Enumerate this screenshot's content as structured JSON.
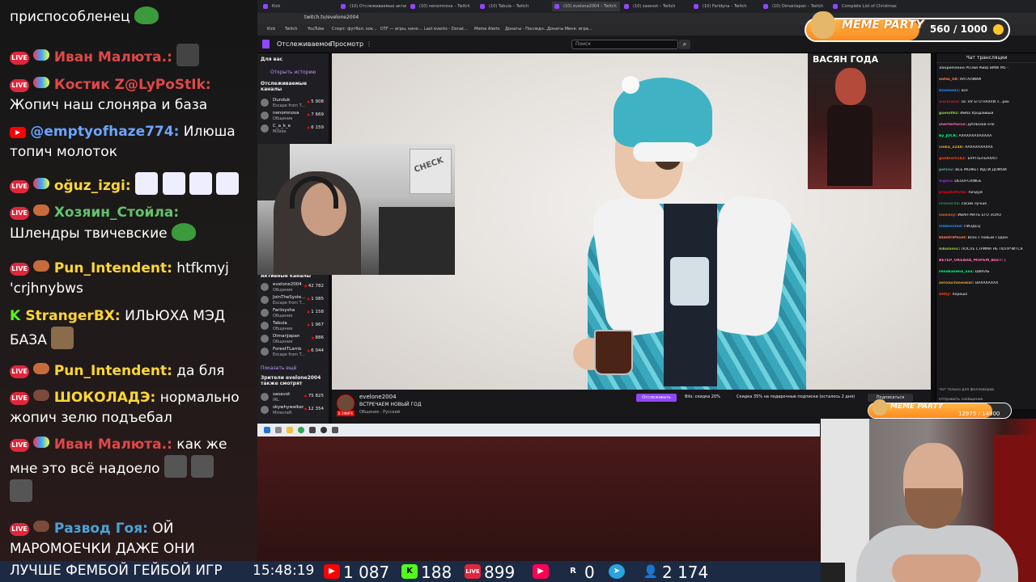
{
  "chat": {
    "messages": [
      {
        "platform": "twitch",
        "nick": "",
        "nick_color": "#ffffff",
        "text": "приспособленец"
      },
      {
        "platform": "vk",
        "nick": "Иван Малюта.:",
        "nick_color": "#e04848",
        "text": ""
      },
      {
        "platform": "vk",
        "nick": "Костик Z@LyPoStIk:",
        "nick_color": "#e04848",
        "text": "Жопич наш слоняра и база"
      },
      {
        "platform": "youtube",
        "nick": "@emptyofhaze774:",
        "nick_color": "#6aa5ff",
        "text": "Илюша топич молоток"
      },
      {
        "platform": "vk",
        "nick": "oğuz_izgi:",
        "nick_color": "#ffd733",
        "text": ""
      },
      {
        "platform": "vk",
        "nick": "Хозяин_Стойла:",
        "nick_color": "#63c26b",
        "text": "Шлендры твичевские"
      },
      {
        "platform": "vk",
        "nick": "Pun_Intendent:",
        "nick_color": "#ffd733",
        "text": "htfkmyj 'crjhnybws"
      },
      {
        "platform": "kick",
        "nick": "StrangerBX:",
        "nick_color": "#ffd733",
        "text": "ИЛЬЮХА МЭД БАЗА"
      },
      {
        "platform": "vk",
        "nick": "Pun_Intendent:",
        "nick_color": "#ffd733",
        "text": "да бля"
      },
      {
        "platform": "vk",
        "nick": "ШОКОЛАДЭ:",
        "nick_color": "#ffd733",
        "text": "нормально жопич зелю подъебал"
      },
      {
        "platform": "vk",
        "nick": "Иван Малюта.:",
        "nick_color": "#e04848",
        "text": "как же мне это всё надоело"
      },
      {
        "platform": "vk",
        "nick": "Развод Гоя:",
        "nick_color": "#4aa3d8",
        "text": "ОЙ МАРОМОЕЧКИ ДАЖЕ ОНИ"
      }
    ]
  },
  "browser": {
    "tabs": [
      "Kick",
      "(10) Отслеживаемые активн.",
      "(10) nenomnova – Twitch",
      "(10) Tabula – Twitch",
      "(10) evelone2004 – Twitch",
      "(10) zasevot – Twitch",
      "(10) Feridyna – Twitch",
      "(10) Dimanlapan – Twitch",
      "Complete List of Christmas"
    ],
    "url": "twitch.tv/evelone2004",
    "bookmarks": [
      "Kick",
      "Twitch",
      "YouTube",
      "Спорт: футбол, хок...",
      "DTF — игры, кино...",
      "Last events - Donat...",
      "Meme Alerts",
      "Донаты - Последн...",
      "Донаты Меня: игра..."
    ],
    "nav": {
      "following": "Отслеживаемое",
      "browse": "Просмотр",
      "search_placeholder": "Поиск"
    },
    "sidenav": {
      "for_you": "Для вас",
      "open_history": "Открыть историю",
      "followed_header": "Отслеживаемые каналы",
      "followed": [
        {
          "name": "Dunduk",
          "game": "Escape from T...",
          "viewers": "5 908"
        },
        {
          "name": "nenomnova",
          "game": "Общение",
          "viewers": "7 669"
        },
        {
          "name": "C_a_k_e",
          "game": "MiSide",
          "viewers": "6 159"
        }
      ],
      "active_header": "Активные каналы",
      "active": [
        {
          "name": "evelone2004",
          "game": "Общение",
          "viewers": "42 782"
        },
        {
          "name": "JoinTheSyste...",
          "game": "Escape from T...",
          "viewers": "1 085"
        },
        {
          "name": "Fariisysha",
          "game": "Общение",
          "viewers": "1 158"
        },
        {
          "name": "Tabula",
          "game": "Общение",
          "viewers": "1 967"
        },
        {
          "name": "DimanJapan",
          "game": "Общение",
          "viewers": "886"
        },
        {
          "name": "ForestTLamb",
          "game": "Escape from T...",
          "viewers": "6 044"
        }
      ],
      "show_more": "Показать ещё",
      "also_watch": "Зрители evelone2004 также смотрят",
      "recommended": [
        {
          "name": "sasavot",
          "game": "IRL",
          "viewers": "75 825"
        },
        {
          "name": "skywhywalker",
          "game": "Minecraft",
          "viewers": "12 354"
        }
      ]
    },
    "stream": {
      "poster_text": "ВАСЯН ГОДА",
      "streamer": "evelone2004",
      "title": "ВСТРЕЧАЕМ НОВЫЙ ГОД",
      "tags": "Общение · Русский",
      "live": "В ЭФИРЕ",
      "follow": "Отслеживать",
      "bits_offer": "Bits: скидка 20%",
      "sub_offer": "Скидка 35% на подарочные подписки (осталось 2 дня)",
      "subscribe": "Подписаться"
    },
    "twitch_chat": {
      "header": "Чат трансляции",
      "lines": [
        {
          "nick": "Закреплено",
          "color": "#adadb8",
          "text": "РОЗЫГРЫШ BMW M5 -"
        },
        {
          "nick": "sofas_58:",
          "color": "#ff7f50",
          "text": "НАТАЛИИИ"
        },
        {
          "nick": "Doomed1:",
          "color": "#1e90ff",
          "text": "все"
        },
        {
          "nick": "wormand:",
          "color": "#b22222",
          "text": "за: НУ ЕГО НАХУЙ з...рек"
        },
        {
          "nick": "guenit92:",
          "color": "#9acd32",
          "text": "Имба Уродливый"
        },
        {
          "nick": "sherterforce:",
          "color": "#ff69b4",
          "text": "ДАЛБОЁВ еле"
        },
        {
          "nick": "by_JOCK:",
          "color": "#00ff7f",
          "text": "АХАХАХАХАХАХА"
        },
        {
          "nick": "cieba_2248:",
          "color": "#daa520",
          "text": "ААХАХАХАХАХ"
        },
        {
          "nick": "goldhart182:",
          "color": "#ff4500",
          "text": "ЪУРПЪЛЪАХАП"
        },
        {
          "nick": "petrov:",
          "color": "#5f9ea0",
          "text": "ВСЕ МОЖЕТ ИДТИ ДОМОЙ"
        },
        {
          "nick": "Sigma:",
          "color": "#8a2be2",
          "text": "DESOFCRINGE"
        },
        {
          "nick": "proosteffvhb:",
          "color": "#ff0000",
          "text": "пиздуй"
        },
        {
          "nick": "crinver54:",
          "color": "#2e8b57",
          "text": "сасим лучше"
        },
        {
          "nick": "swaissy:",
          "color": "#d2691e",
          "text": "ИВАН МАТЬ ЕГО ЗОЛО"
        },
        {
          "nick": "vladosvlad:",
          "color": "#1e90ff",
          "text": "ПИЗДЕЦ"
        },
        {
          "nick": "DimitriPhoel:",
          "color": "#ff7f50",
          "text": "Всех с Новым Годом"
        },
        {
          "nick": "nikolaivic:",
          "color": "#9acd32",
          "text": "ПОСЛЕ СТРИМА НЕ ПОЛУЧИТСЯ"
        },
        {
          "nick": "ВЕТЕР_ОКЕАНА_МОРЕМ_ВЕЕТ:",
          "color": "#ff69b4",
          "text": ")"
        },
        {
          "nick": "renokasena_xxx:",
          "color": "#00ff7f",
          "text": "ШВАЛЬ"
        },
        {
          "nick": "zeroluchmenkar:",
          "color": "#daa520",
          "text": "ВАХАХАХАХ"
        },
        {
          "nick": "zetty:",
          "color": "#ff4500",
          "text": "Хорошо"
        }
      ],
      "followers_only": "Чат только для фолловеров",
      "send": "Отправить сообщение"
    }
  },
  "meme_party": {
    "label": "MEME PARTY",
    "count": "560 / 1000",
    "progress": 0.56
  },
  "meme_party_small": {
    "label": "MEME PARTY",
    "count": "12975 / 14900",
    "progress": 0.87
  },
  "status": {
    "ticker": "ЛУЧШЕ ФЕМБОЙ ГЕЙБОЙ ИГР",
    "time": "15:48:19",
    "youtube": "1 087",
    "kick": "188",
    "vk": "899",
    "twitch_ic": "",
    "rutube": "0",
    "telegram": "",
    "viewers": "2 174"
  },
  "colors": {
    "twitch": "#9146ff",
    "live_red": "#eb0400",
    "kick": "#53fc18",
    "youtube": "#ff0000",
    "vk_live": "#e0263b"
  }
}
